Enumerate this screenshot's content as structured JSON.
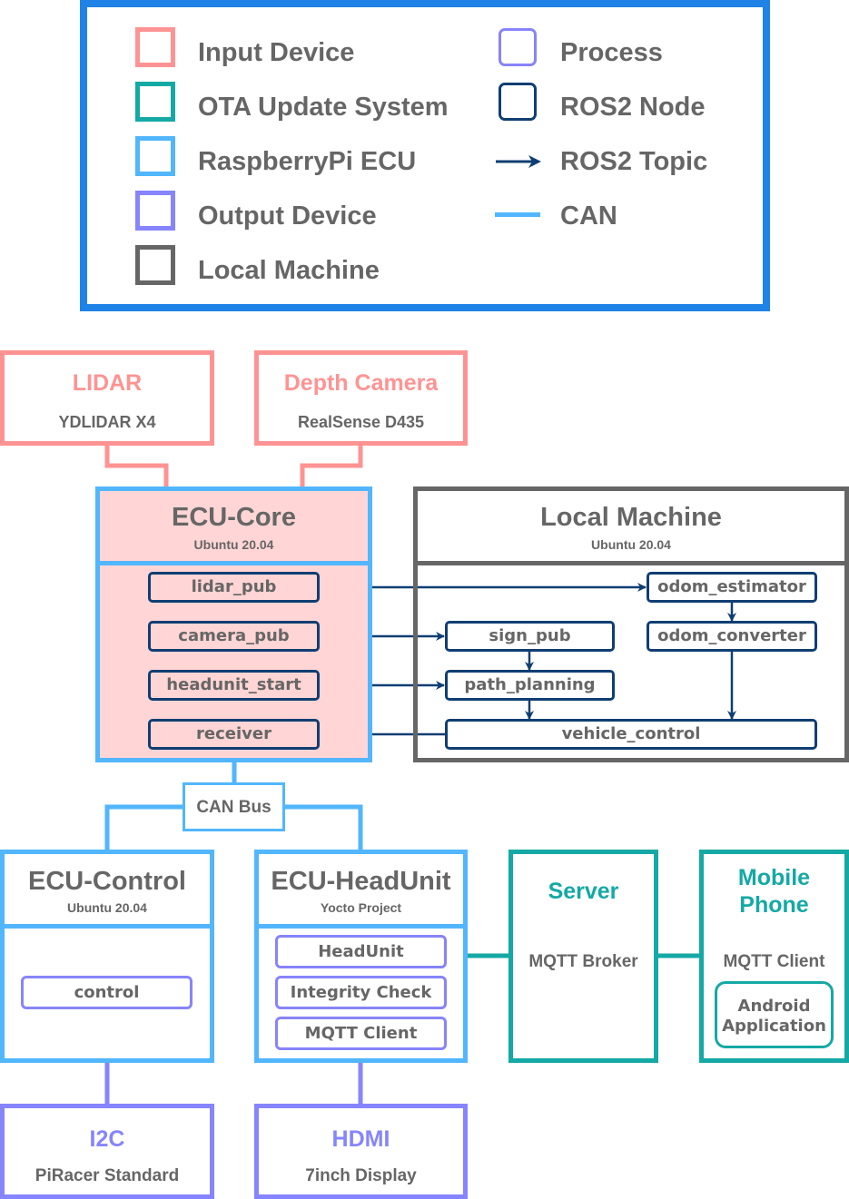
{
  "legend": {
    "items_left": [
      {
        "label": "Input Device",
        "color": "#FF9393",
        "icon": "square-outline-icon"
      },
      {
        "label": "OTA Update System",
        "color": "#14A9A5",
        "icon": "square-outline-icon"
      },
      {
        "label": "RaspberryPi ECU",
        "color": "#52B6FE",
        "icon": "square-outline-icon"
      },
      {
        "label": "Output Device",
        "color": "#8685FE",
        "icon": "square-outline-icon"
      },
      {
        "label": "Local Machine",
        "color": "#666666",
        "icon": "square-outline-icon"
      }
    ],
    "items_right": [
      {
        "label": "Process",
        "color": "#8784FB",
        "icon": "rounded-square-icon"
      },
      {
        "label": "ROS2 Node",
        "color": "#0F3E72",
        "icon": "rounded-square-icon"
      },
      {
        "label": "ROS2 Topic",
        "color": "#0F3E72",
        "icon": "arrow-right-icon"
      },
      {
        "label": "CAN",
        "color": "#52B6FE",
        "icon": "line-icon"
      }
    ],
    "border_color": "#1F82E6"
  },
  "inputs": {
    "lidar": {
      "title": "LIDAR",
      "subtitle": "YDLIDAR X4"
    },
    "camera": {
      "title": "Depth Camera",
      "subtitle": "RealSense D435"
    }
  },
  "ecu_core": {
    "title": "ECU-Core",
    "os": "Ubuntu 20.04",
    "fill": "#FFD5D5",
    "nodes": [
      "lidar_pub",
      "camera_pub",
      "headunit_start",
      "receiver"
    ]
  },
  "local_machine": {
    "title": "Local Machine",
    "os": "Ubuntu 20.04",
    "nodes": {
      "odom_estimator": "odom_estimator",
      "odom_converter": "odom_converter",
      "sign_pub": "sign_pub",
      "path_planning": "path_planning",
      "vehicle_control": "vehicle_control"
    }
  },
  "can_bus": {
    "label": "CAN Bus"
  },
  "ecu_control": {
    "title": "ECU-Control",
    "os": "Ubuntu 20.04",
    "processes": [
      "control"
    ]
  },
  "ecu_headunit": {
    "title": "ECU-HeadUnit",
    "os": "Yocto Project",
    "processes": [
      "HeadUnit",
      "Integrity Check",
      "MQTT Client"
    ]
  },
  "server": {
    "title": "Server",
    "subtitle": "MQTT Broker"
  },
  "mobile": {
    "title_line1": "Mobile",
    "title_line2": "Phone",
    "subtitle": "MQTT Client",
    "app_line1": "Android",
    "app_line2": "Application"
  },
  "outputs": {
    "i2c": {
      "title": "I2C",
      "subtitle": "PiRacer Standard"
    },
    "hdmi": {
      "title": "HDMI",
      "subtitle": "7inch Display"
    }
  },
  "colors": {
    "input": "#FF9393",
    "ota": "#14A9A5",
    "rpi": "#52B6FE",
    "output": "#8685FE",
    "local": "#666666",
    "ros_node": "#0F3E72",
    "process": "#8784FB",
    "text": "#666666"
  }
}
